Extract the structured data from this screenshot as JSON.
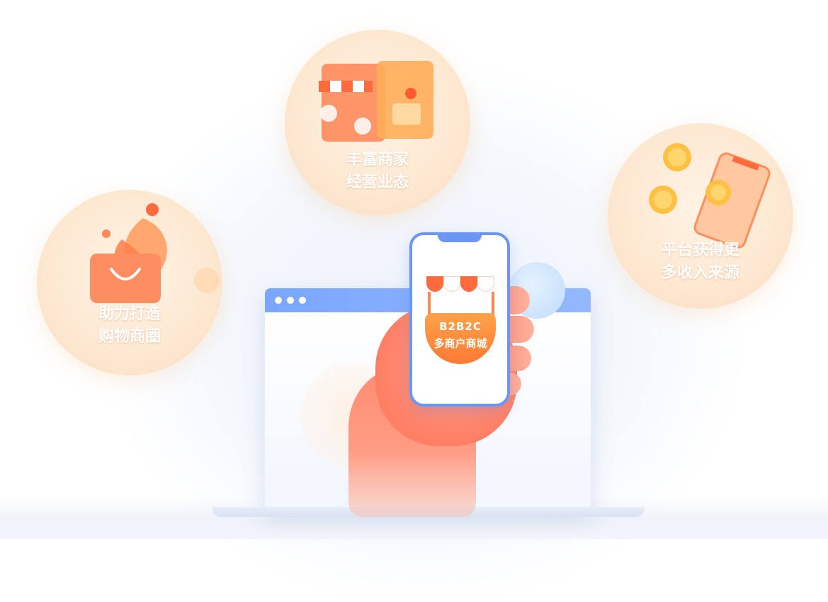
{
  "bubbles": {
    "left": {
      "line1": "助力打造",
      "line2": "购物商圈"
    },
    "top": {
      "line1": "丰富商家",
      "line2": "经营业态"
    },
    "right": {
      "line1": "平台获得更",
      "line2": "多收入来源"
    }
  },
  "phone_badge": {
    "line1": "B2B2C",
    "line2": "多商户商城"
  },
  "icons": {
    "left": "shopping-bag-icon",
    "top": "storefront-icon",
    "right": "coins-phone-icon",
    "phone": "market-stall-icon"
  },
  "colors": {
    "accent_orange": "#ff7a33",
    "accent_blue": "#6b96f4",
    "bubble_fill": "#fde9d3"
  }
}
